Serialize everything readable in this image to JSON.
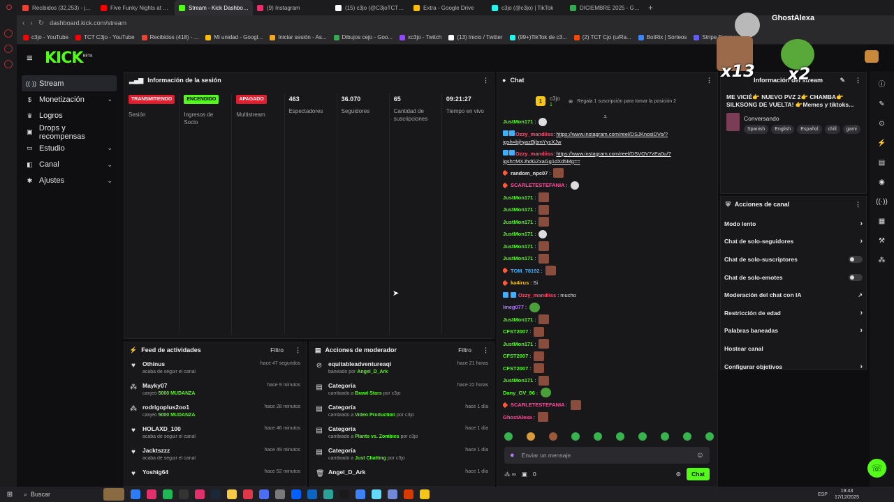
{
  "browser": {
    "tabs": [
      {
        "title": "Recibidos (32,253) - jose",
        "color": "#ea4335"
      },
      {
        "title": "Five Funky Nights at Fred",
        "color": "#ff0000"
      },
      {
        "title": "Stream - Kick Dashboard",
        "color": "#53fc18",
        "active": true
      },
      {
        "title": "(9) Instagram",
        "color": "#e1306c"
      },
      {
        "title": "(15) c3jo (@C3joTCT) / X",
        "color": "#ffffff"
      },
      {
        "title": "Extra - Google Drive",
        "color": "#fbbc04"
      },
      {
        "title": "c3jo (@c3jo) | TikTok",
        "color": "#25f4ee"
      },
      {
        "title": "DICIEMBRE 2025 - Googl",
        "color": "#34a853"
      }
    ],
    "url": "dashboard.kick.com/stream",
    "bookmarks": [
      {
        "label": "c3jo - YouTube",
        "color": "#ff0000"
      },
      {
        "label": "TCT C3jo - YouTube",
        "color": "#ff0000"
      },
      {
        "label": "Recibidos (418) - ...",
        "color": "#ea4335"
      },
      {
        "label": "Mi unidad - Googl...",
        "color": "#fbbc04"
      },
      {
        "label": "Iniciar sesión - As...",
        "color": "#f5a623"
      },
      {
        "label": "Dibujos cejo - Goo...",
        "color": "#34a853"
      },
      {
        "label": "xc3jo - Twitch",
        "color": "#9146ff"
      },
      {
        "label": "(13) Inicio / Twitter",
        "color": "#ffffff"
      },
      {
        "label": "(99+)TikTok de c3...",
        "color": "#25f4ee"
      },
      {
        "label": "(2) TCT Cjo (u/Ra...",
        "color": "#ff4500"
      },
      {
        "label": "BotRix | Sorteos",
        "color": "#3a86ff"
      },
      {
        "label": "Stripe Express",
        "color": "#635bff"
      }
    ]
  },
  "kick": {
    "logo": "KICK",
    "logo_sup": "BETA"
  },
  "sidebar": {
    "items": [
      {
        "label": "Stream",
        "icon": "broadcast-icon",
        "glyph": "((·))",
        "active": true,
        "chevron": false
      },
      {
        "label": "Monetización",
        "icon": "money-icon",
        "glyph": "$",
        "chevron": true
      },
      {
        "label": "Logros",
        "icon": "trophy-icon",
        "glyph": "♛",
        "chevron": false
      },
      {
        "label": "Drops y recompensas",
        "icon": "gift-icon",
        "glyph": "▣",
        "chevron": false
      },
      {
        "label": "Estudio",
        "icon": "studio-icon",
        "glyph": "▭",
        "chevron": true
      },
      {
        "label": "Canal",
        "icon": "channel-icon",
        "glyph": "◧",
        "chevron": true
      },
      {
        "label": "Ajustes",
        "icon": "gear-icon",
        "glyph": "✱",
        "chevron": true
      }
    ]
  },
  "session": {
    "title": "Información de la sesión",
    "stats": [
      {
        "pill": "TRANSMITIENDO",
        "pill_color": "#e11d2e",
        "label": "Sesión"
      },
      {
        "pill": "ENCENDIDO",
        "pill_color": "#53fc18",
        "label": "Ingresos de Socio"
      },
      {
        "pill": "APAGADO",
        "pill_color": "#e11d2e",
        "label": "Multistream"
      },
      {
        "value": "463",
        "label": "Espectadores"
      },
      {
        "value": "36.070",
        "label": "Seguidores"
      },
      {
        "value": "65",
        "label": "Cantidad de suscripciones"
      },
      {
        "value": "09:21:27",
        "label": "Tiempo en vivo"
      }
    ]
  },
  "feed": {
    "title": "Feed de actividades",
    "filter": "Filtro",
    "items": [
      {
        "icon": "heart-icon",
        "glyph": "♥",
        "name": "Othinus",
        "pre": "acaba de seguir el canal",
        "hl": "",
        "time": "hace 47 segundos"
      },
      {
        "icon": "points-icon",
        "glyph": "⁂",
        "name": "Mayky07",
        "pre": "canjeó ",
        "hl": "5000 MUDANZA",
        "time": "hace 9 minutos"
      },
      {
        "icon": "points-icon",
        "glyph": "⁂",
        "name": "rodrigoplus2oo1",
        "pre": "canjeó ",
        "hl": "5000 MUDANZA",
        "time": "hace 28 minutos"
      },
      {
        "icon": "heart-icon",
        "glyph": "♥",
        "name": "HOLAXD_100",
        "pre": "acaba de seguir el canal",
        "hl": "",
        "time": "hace 46 minutos"
      },
      {
        "icon": "heart-icon",
        "glyph": "♥",
        "name": "Jacktszzz",
        "pre": "acaba de seguir el canal",
        "hl": "",
        "time": "hace 49 minutos"
      },
      {
        "icon": "heart-icon",
        "glyph": "♥",
        "name": "Yoshig64",
        "pre": "",
        "hl": "",
        "time": "hace 52 minutos"
      }
    ]
  },
  "mod": {
    "title": "Acciones de moderador",
    "filter": "Filtro",
    "items": [
      {
        "icon": "ban-icon",
        "glyph": "⊘",
        "name": "equitableadventureaqi",
        "pre": "baneado por ",
        "hl": "Angel_D_Ark",
        "post": "",
        "time": "hace 21 horas"
      },
      {
        "icon": "category-icon",
        "glyph": "▤",
        "name": "Categoría",
        "pre": "cambiado a ",
        "hl": "Brawl Stars",
        "post": " por c3jo",
        "time": "hace 22 horas"
      },
      {
        "icon": "category-icon",
        "glyph": "▤",
        "name": "Categoría",
        "pre": "cambiado a ",
        "hl": "Video Production",
        "post": " por c3jo",
        "time": "hace 1 día"
      },
      {
        "icon": "category-icon",
        "glyph": "▤",
        "name": "Categoría",
        "pre": "cambiado a ",
        "hl": "Plants vs. Zombies",
        "post": " por c3jo",
        "time": "hace 1 día"
      },
      {
        "icon": "category-icon",
        "glyph": "▤",
        "name": "Categoría",
        "pre": "cambiado a ",
        "hl": "Just Chatting",
        "post": " por c3jo",
        "time": "hace 1 día"
      },
      {
        "icon": "trash-icon",
        "glyph": "🗑",
        "name": "Angel_D_Ark",
        "pre": "",
        "hl": "",
        "post": "",
        "time": "hace 1 día"
      }
    ]
  },
  "chat": {
    "title": "Chat",
    "pinned_user": "c3jo",
    "pinned_rank": "1",
    "pinned_count": "1",
    "pinned_msg": "Regala 1 suscripción para tomar la posición 2",
    "lines": [
      {
        "user": "JustMon171",
        "color": "#53fc18",
        "emote": "gh"
      },
      {
        "user": "Ozzy_mandiiss",
        "color": "#ff4d6d",
        "badges": 2,
        "link": "https://www.instagram.com/reel/DSJKnosiDVo/?igsh=bjhyazBjbmYycXJw",
        "two": true
      },
      {
        "user": "Ozzy_mandiiss",
        "color": "#ff4d6d",
        "badges": 2,
        "link": "https://www.instagram.com/reel/DSVOV7zEa0u/?igsh=MXJhdGZxaGg1dXd5Mg==",
        "two": true
      },
      {
        "user": "random_npc07",
        "color": "#e6e6e6",
        "obadge": true,
        "emote": "emote"
      },
      {
        "user": "SCARLETESTEFANIA",
        "color": "#ff4d9a",
        "obadge": true,
        "emote": "gh"
      },
      {
        "user": "JustMon171",
        "color": "#53fc18",
        "emote": "emote"
      },
      {
        "user": "JustMon171",
        "color": "#53fc18",
        "emote": "emote"
      },
      {
        "user": "JustMon171",
        "color": "#53fc18",
        "emote": "emote"
      },
      {
        "user": "JustMon171",
        "color": "#53fc18",
        "emote": "gh"
      },
      {
        "user": "JustMon171",
        "color": "#53fc18",
        "emote": "emote"
      },
      {
        "user": "JustMon171",
        "color": "#53fc18",
        "emote": "emote"
      },
      {
        "user": "TOM_78192",
        "color": "#3db0ff",
        "obadge": true,
        "emote": "emote"
      },
      {
        "user": "ka4irus",
        "color": "#f5c518",
        "obadge": true,
        "text": "Si"
      },
      {
        "user": "Ozzy_mandiiss",
        "color": "#ff4d6d",
        "badges": 2,
        "text": "mucho"
      },
      {
        "user": "lmeg077",
        "color": "#b07cff",
        "emote": "pep"
      },
      {
        "user": "JustMon171",
        "color": "#53fc18",
        "emote": "emote"
      },
      {
        "user": "CFST2007",
        "color": "#53fc18",
        "emote": "emote"
      },
      {
        "user": "JustMon171",
        "color": "#53fc18",
        "emote": "emote"
      },
      {
        "user": "CFST2007",
        "color": "#53fc18",
        "emote": "emote"
      },
      {
        "user": "CFST2007",
        "color": "#53fc18",
        "emote": "emote"
      },
      {
        "user": "JustMon171",
        "color": "#53fc18",
        "emote": "emote"
      },
      {
        "user": "Dany_GV_96",
        "color": "#53fc18",
        "emote": "pep"
      },
      {
        "user": "SCARLETESTEFANIA",
        "color": "#ff4d9a",
        "obadge": true,
        "emote": "emote"
      },
      {
        "user": "GhostAlexa",
        "color": "#ff4d9a",
        "emote": "emote"
      }
    ],
    "placeholder": "Enviar un mensaje",
    "points": "0",
    "send": "Chat"
  },
  "streaminfo": {
    "title": "Información del stream",
    "stream_title": "ME VICIÉ👉 NUEVO PVZ 2👉 CHAMBA👉 SILKSONG DE VUELTA! 👉Memes y tiktoks...",
    "category": "Conversando",
    "tags": [
      "Spanish",
      "English",
      "Español",
      "chill",
      "gami"
    ]
  },
  "actions": {
    "title": "Acciones de canal",
    "items": [
      {
        "label": "Modo lento",
        "ctl": "chevron"
      },
      {
        "label": "Chat de solo-seguidores",
        "ctl": "chevron"
      },
      {
        "label": "Chat de solo-suscriptores",
        "ctl": "toggle"
      },
      {
        "label": "Chat de solo-emotes",
        "ctl": "toggle"
      },
      {
        "label": "Moderación del chat con IA",
        "ctl": "external"
      },
      {
        "label": "Restricción de edad",
        "ctl": "chevron"
      },
      {
        "label": "Palabras baneadas",
        "ctl": "chevron"
      },
      {
        "label": "Hostear canal",
        "ctl": "none"
      },
      {
        "label": "Configurar objetivos",
        "ctl": "chevron"
      }
    ]
  },
  "overlay": {
    "name": "GhostAlexa",
    "x13": "x13",
    "x2": "x2"
  },
  "taskbar": {
    "search": "Buscar",
    "lang": "ESP",
    "time": "19:43",
    "date": "17/12/2025"
  }
}
